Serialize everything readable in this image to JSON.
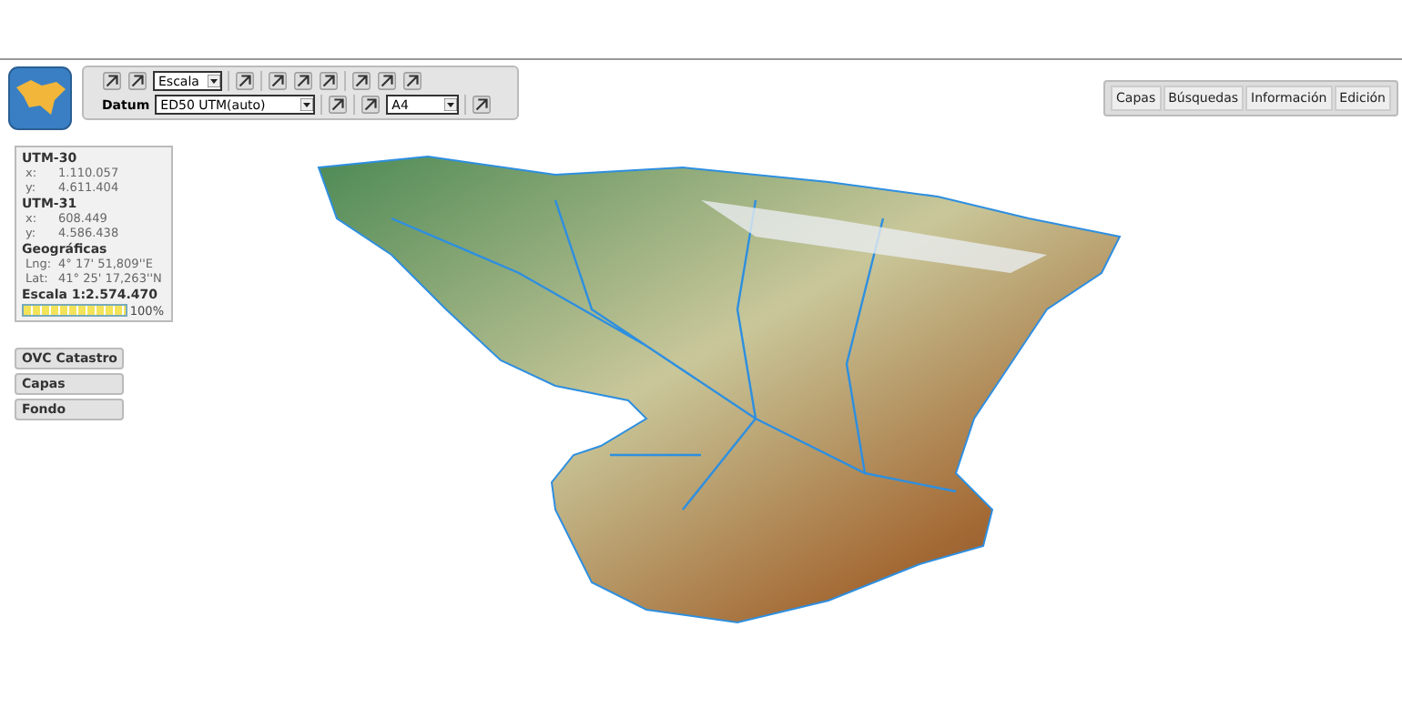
{
  "toolbar": {
    "scale_select": "Escala",
    "datum_label": "Datum",
    "datum_select": "ED50 UTM(auto)",
    "paper_select": "A4"
  },
  "top_tabs": [
    "Capas",
    "Búsquedas",
    "Información",
    "Edición"
  ],
  "coordinates": {
    "groups": [
      {
        "title": "UTM-30",
        "rows": [
          {
            "label": "x:",
            "value": "1.110.057"
          },
          {
            "label": "y:",
            "value": "4.611.404"
          }
        ]
      },
      {
        "title": "UTM-31",
        "rows": [
          {
            "label": "x:",
            "value": "608.449"
          },
          {
            "label": "y:",
            "value": "4.586.438"
          }
        ]
      },
      {
        "title": "Geográficas",
        "rows": [
          {
            "label": "Lng:",
            "value": "4° 17' 51,809''E"
          },
          {
            "label": "Lat:",
            "value": "41° 25' 17,263''N"
          }
        ]
      }
    ],
    "scale": "Escala 1:2.574.470",
    "zoom": {
      "level": 1,
      "reading": "100%"
    }
  },
  "side_buttons": [
    "OVC Catastro",
    "Capas",
    "Fondo"
  ]
}
